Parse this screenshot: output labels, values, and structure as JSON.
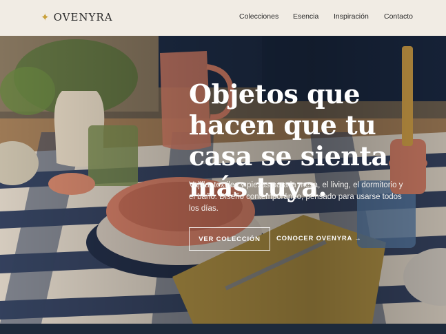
{
  "header": {
    "brand_mark": "✦",
    "brand_name": "OVENYRA",
    "nav": [
      "Colecciones",
      "Esencia",
      "Inspiración",
      "Contacto"
    ]
  },
  "hero": {
    "headline": "Objetos que hacen que tu casa se sienta más tuya.",
    "lead": "Vajilla, textiles y piezas para la mesa, el living, el dormitorio y el baño. Diseño contemporáneo, pensado para usarse todos los días.",
    "primary_cta": "VER COLECCIÓN",
    "secondary_cta": "CONOCER OVENYRA →"
  },
  "colors": {
    "header_bg": "#f1ece4",
    "accent_gold": "#c9a13b",
    "tablecloth_navy": "#2e3f63",
    "terracotta": "#d98a6f"
  }
}
